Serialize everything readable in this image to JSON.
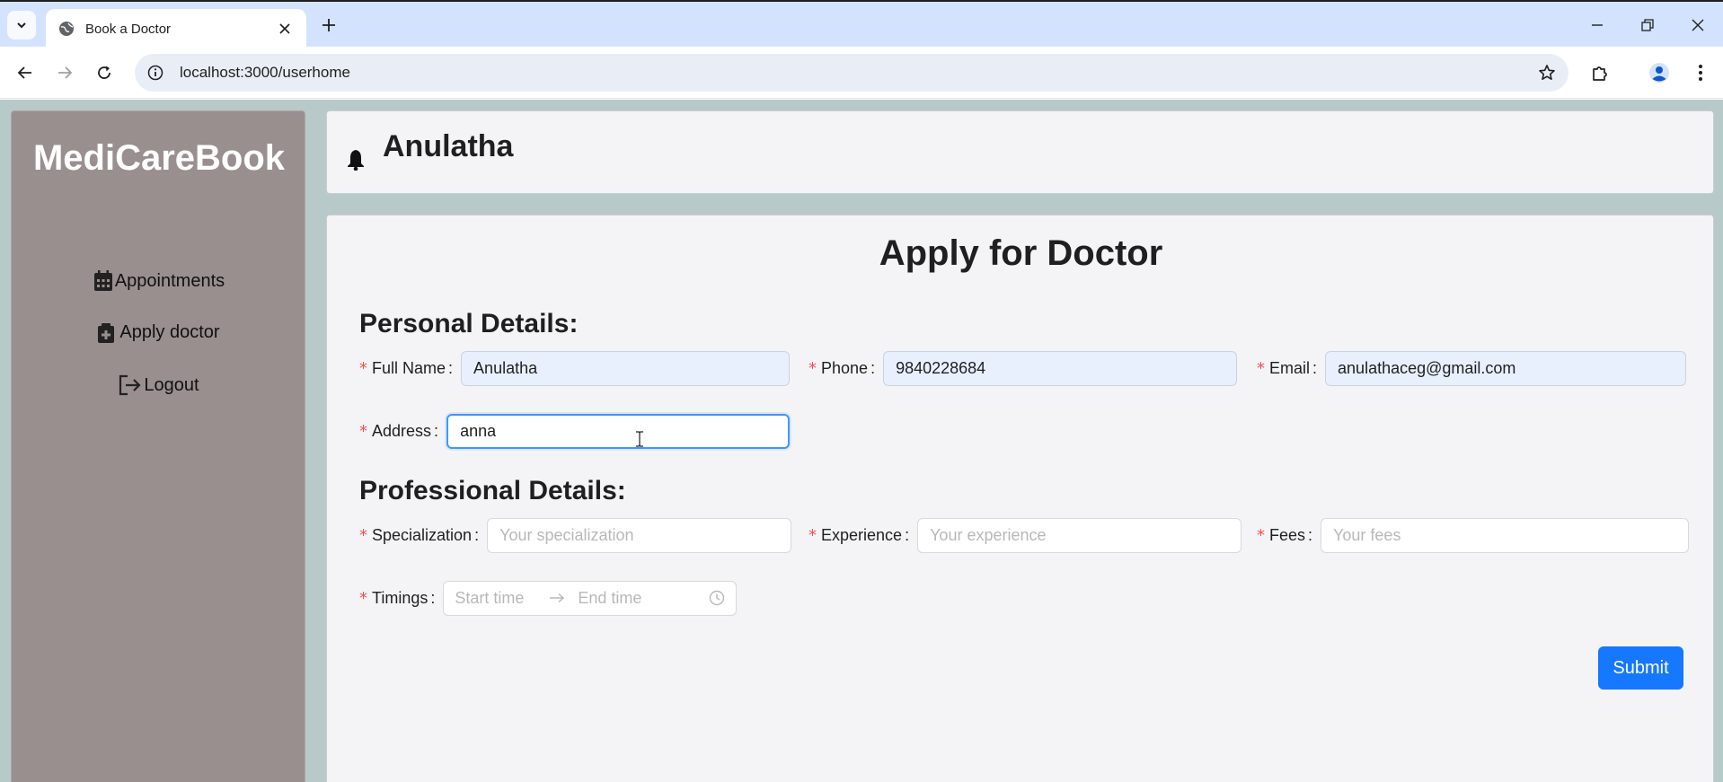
{
  "browser": {
    "tab_title": "Book a Doctor",
    "url": "localhost:3000/userhome"
  },
  "app": {
    "logo": "MediCareBook",
    "nav": [
      {
        "label": "Appointments",
        "icon": "calendar-icon"
      },
      {
        "label": "Apply doctor",
        "icon": "medical-kit-icon"
      },
      {
        "label": "Logout",
        "icon": "logout-icon"
      }
    ],
    "header": {
      "user_name": "Anulatha",
      "icon": "bell-icon"
    }
  },
  "form": {
    "title": "Apply for Doctor",
    "personal_title": "Personal Details:",
    "professional_title": "Professional Details:",
    "full_name": {
      "label": "Full Name",
      "value": "Anulatha"
    },
    "phone": {
      "label": "Phone",
      "value": "9840228684"
    },
    "email": {
      "label": "Email",
      "value": "anulathaceg@gmail.com"
    },
    "address": {
      "label": "Address",
      "value": "anna"
    },
    "specialization": {
      "label": "Specialization",
      "placeholder": "Your specialization"
    },
    "experience": {
      "label": "Experience",
      "placeholder": "Your experience"
    },
    "fees": {
      "label": "Fees",
      "placeholder": "Your fees"
    },
    "timings": {
      "label": "Timings",
      "start_placeholder": "Start time",
      "end_placeholder": "End time"
    },
    "submit_label": "Submit"
  },
  "colors": {
    "primary": "#1677ff",
    "required": "#ff4d4f",
    "sidebar": "#9a8f8f",
    "page_background": "#b8c9c9"
  }
}
